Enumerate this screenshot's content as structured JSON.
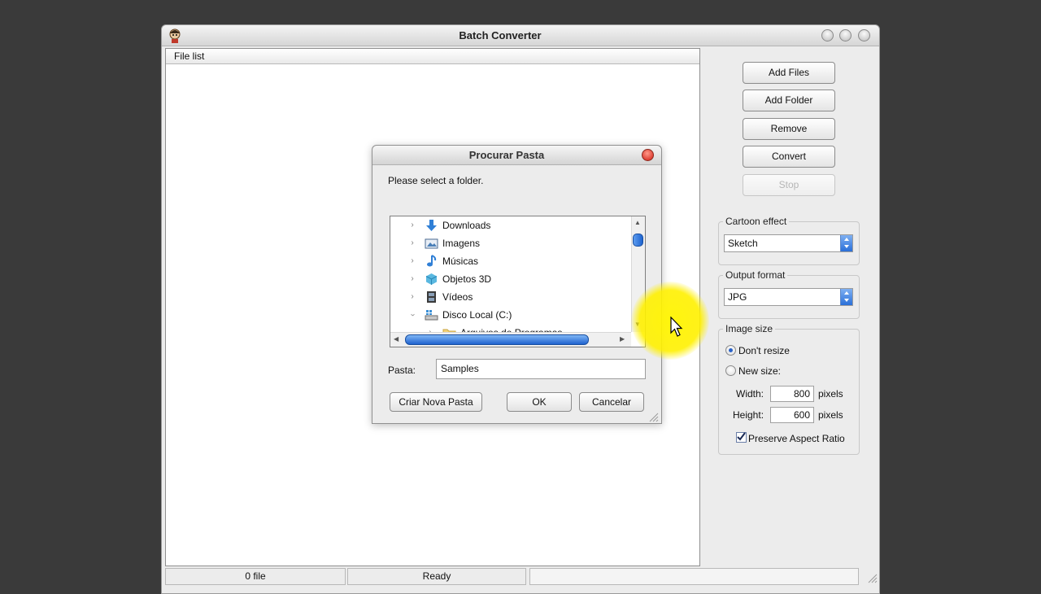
{
  "window": {
    "title": "Batch Converter"
  },
  "file_list": {
    "header": "File list"
  },
  "buttons": {
    "add_files": "Add Files",
    "add_folder": "Add Folder",
    "remove": "Remove",
    "convert": "Convert",
    "stop": "Stop"
  },
  "cartoon_effect": {
    "label": "Cartoon effect",
    "value": "Sketch"
  },
  "output_format": {
    "label": "Output format",
    "value": "JPG"
  },
  "image_size": {
    "label": "Image size",
    "dont_resize": "Don't resize",
    "new_size": "New size:",
    "selected": "dont_resize",
    "width_label": "Width:",
    "width_value": "800",
    "height_label": "Height:",
    "height_value": "600",
    "unit": "pixels",
    "preserve_label": "Preserve Aspect Ratio",
    "preserve_checked": true
  },
  "status": {
    "files": "0 file",
    "state": "Ready"
  },
  "dialog": {
    "title": "Procurar Pasta",
    "prompt": "Please select a folder.",
    "tree": [
      {
        "label": "Downloads",
        "icon": "download-arrow-icon",
        "expanded": false
      },
      {
        "label": "Imagens",
        "icon": "pictures-icon",
        "expanded": false
      },
      {
        "label": "Músicas",
        "icon": "music-note-icon",
        "expanded": false
      },
      {
        "label": "Objetos 3D",
        "icon": "cube-icon",
        "expanded": false
      },
      {
        "label": "Vídeos",
        "icon": "film-icon",
        "expanded": false
      },
      {
        "label": "Disco Local (C:)",
        "icon": "drive-icon",
        "expanded": true
      },
      {
        "label": "Arquivos de Programas",
        "icon": "folder-icon",
        "expanded": false
      }
    ],
    "folder_label": "Pasta:",
    "folder_value": "Samples",
    "new_folder_button": "Criar Nova Pasta",
    "ok_button": "OK",
    "cancel_button": "Cancelar"
  },
  "colors": {
    "accent": "#2a6fd8",
    "cursor_highlight": "#fff200",
    "close_red": "#d01a10"
  }
}
